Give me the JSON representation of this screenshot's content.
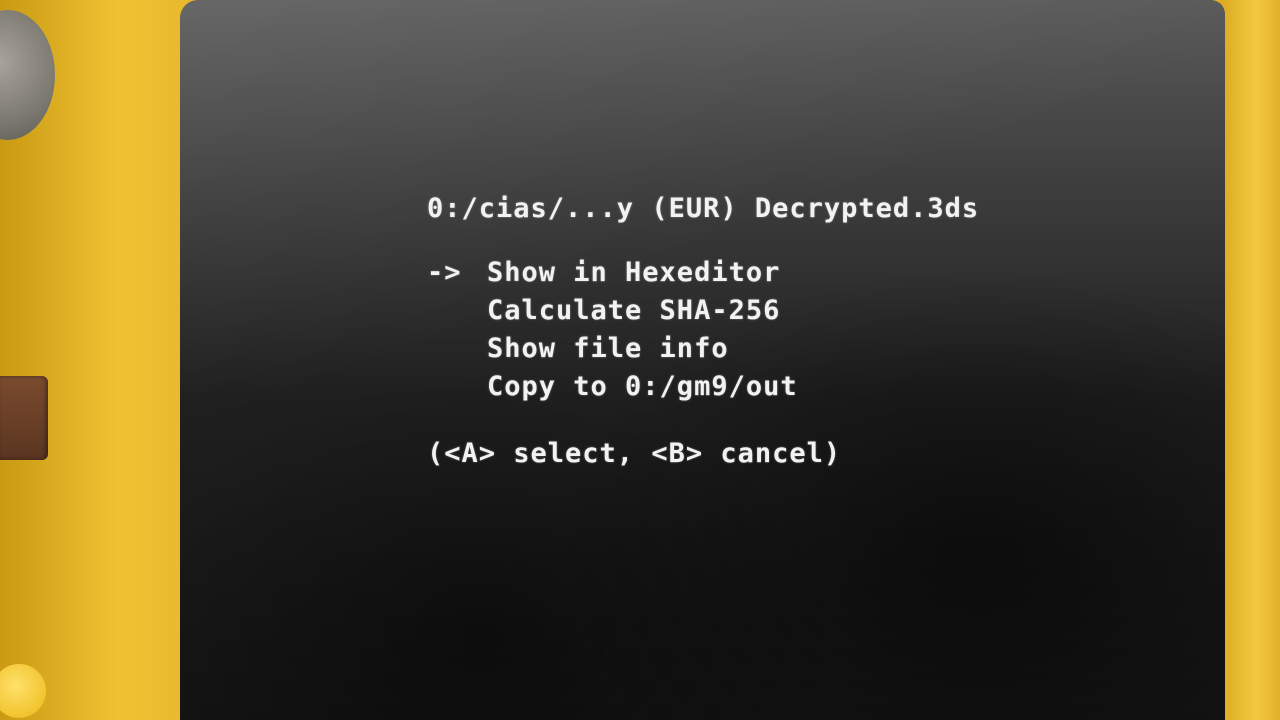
{
  "screen": {
    "path": "0:/cias/...y (EUR) Decrypted.3ds",
    "cursor_symbol": "->",
    "menu": [
      {
        "label": "Show in Hexeditor",
        "selected": true
      },
      {
        "label": "Calculate SHA-256",
        "selected": false
      },
      {
        "label": "Show file info",
        "selected": false
      },
      {
        "label": "Copy to 0:/gm9/out",
        "selected": false
      }
    ],
    "hint": "(<A> select, <B> cancel)"
  }
}
